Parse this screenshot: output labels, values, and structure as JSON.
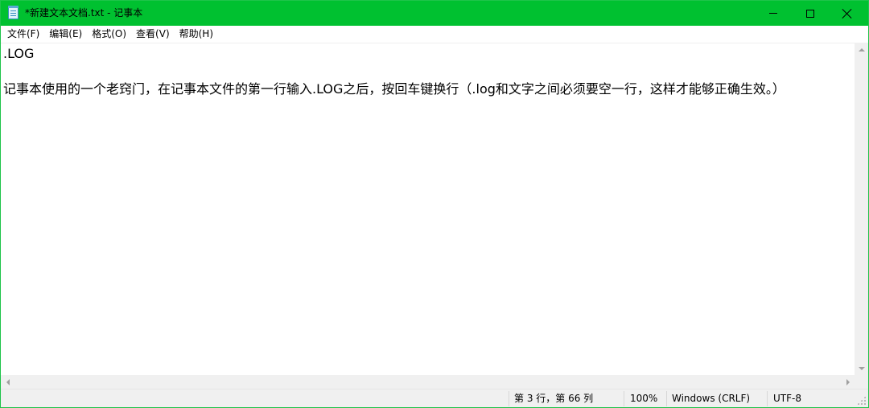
{
  "window": {
    "title": "*新建文本文档.txt - 记事本",
    "accent_color": "#00c130"
  },
  "titlebar": {
    "app_icon": "notepad-icon",
    "minimize_icon": "minimize-icon",
    "maximize_icon": "maximize-icon",
    "close_icon": "close-icon"
  },
  "menu": {
    "items": [
      {
        "label": "文件(F)"
      },
      {
        "label": "编辑(E)"
      },
      {
        "label": "格式(O)"
      },
      {
        "label": "查看(V)"
      },
      {
        "label": "帮助(H)"
      }
    ]
  },
  "editor": {
    "lines": [
      ".LOG",
      "",
      "记事本使用的一个老窍门，在记事本文件的第一行输入.LOG之后，按回车键换行（.log和文字之间必须要空一行，这样才能够正确生效。）"
    ]
  },
  "statusbar": {
    "position": "第 3 行，第 66 列",
    "zoom": "100%",
    "line_ending": "Windows (CRLF)",
    "encoding": "UTF-8"
  }
}
